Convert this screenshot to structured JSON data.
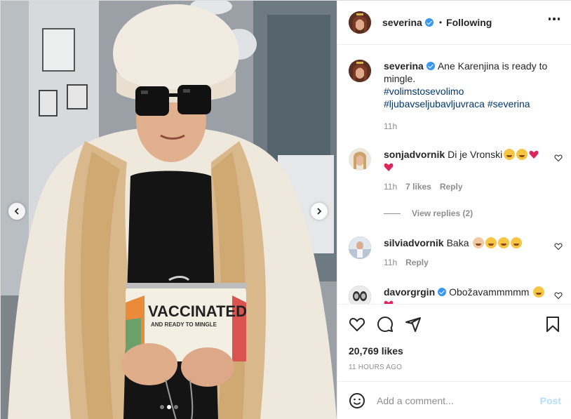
{
  "post": {
    "author": "severina",
    "follow_status": "Following",
    "separator": "•",
    "caption_text": "Ane Karenjina is ready to mingle.",
    "hashtags": [
      "#volimstosevolimo",
      "#ljubavseljubavljuvraca",
      "#severina"
    ],
    "caption_time": "11h",
    "likes": "20,769 likes",
    "posted_ago": "11 HOURS AGO",
    "image_text": {
      "bag_line1": "VACCINATED",
      "bag_line2": "AND READY TO MINGLE"
    },
    "carousel": {
      "count": 3,
      "active": 1
    }
  },
  "comments": [
    {
      "user": "sonjadvornik",
      "text": "Di je Vronski",
      "emoji": [
        "laugh",
        "laugh",
        "heart",
        "heart"
      ],
      "time": "11h",
      "likes": "7 likes",
      "reply": "Reply"
    },
    {
      "user": "silviadvornik",
      "text": "Baka",
      "emoji": [
        "hug",
        "love",
        "love",
        "love"
      ],
      "time": "11h",
      "reply": "Reply"
    },
    {
      "user": "davorgrgin",
      "text": "Obožavammmmm",
      "emoji": [
        "laugh",
        "heart"
      ],
      "verified": true
    }
  ],
  "view_replies": "View replies (2)",
  "add_comment": {
    "placeholder": "Add a comment...",
    "post_label": "Post"
  },
  "colors": {
    "link": "#00376b",
    "verified": "#3897f0",
    "muted": "#8e8e8e",
    "post_disabled": "#b2dffc",
    "heart": "#ed4956"
  }
}
